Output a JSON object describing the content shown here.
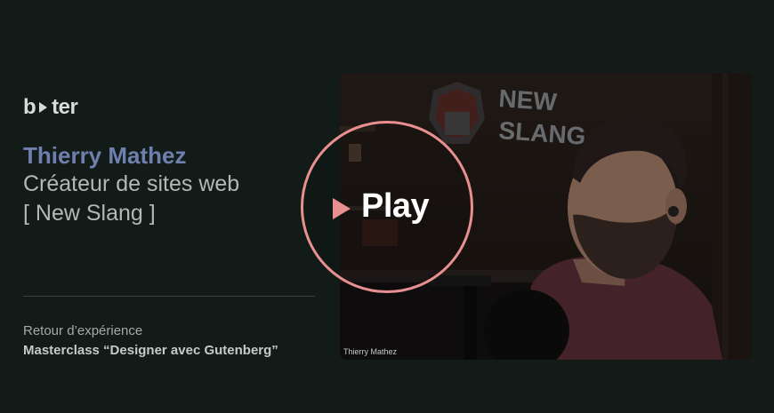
{
  "logo": {
    "text_left": "b",
    "text_right": "ter"
  },
  "speaker": {
    "name": "Thierry Mathez",
    "role": "Créateur de sites web",
    "company": "[ New Slang ]"
  },
  "talk": {
    "kicker": "Retour d’expérience",
    "title": "Masterclass “Designer avec Gutenberg”"
  },
  "video": {
    "caption": "Thierry Mathez",
    "wall_sign": "NEW SLANG",
    "play_label": "Play",
    "play_color": "#e88f90",
    "icon": "play-triangle-icon"
  },
  "colors": {
    "background": "#121b18",
    "accent_name": "#6f7fae"
  }
}
